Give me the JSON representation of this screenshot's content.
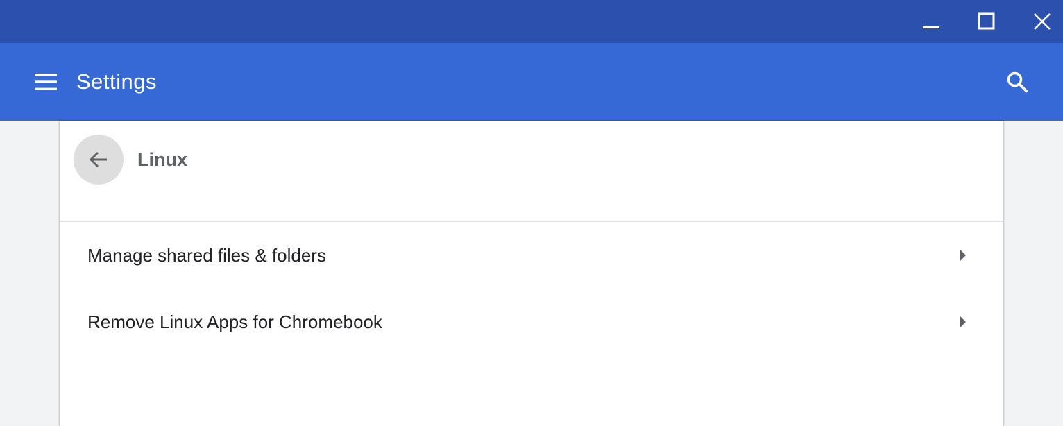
{
  "window_controls": {
    "minimize_icon": "minimize-icon",
    "maximize_icon": "maximize-icon",
    "close_icon": "close-icon"
  },
  "appbar": {
    "title": "Settings",
    "menu_icon": "hamburger-menu-icon",
    "search_icon": "search-icon"
  },
  "subpage": {
    "title": "Linux",
    "back_icon": "arrow-back-icon"
  },
  "rows": [
    {
      "label": "Manage shared files & folders",
      "icon": "arrow-right-icon"
    },
    {
      "label": "Remove Linux Apps for Chromebook",
      "icon": "arrow-right-icon"
    }
  ],
  "colors": {
    "titlebar": "#2c50ad",
    "appbar": "#3668d6",
    "background": "#f1f3f4",
    "card": "#ffffff"
  }
}
